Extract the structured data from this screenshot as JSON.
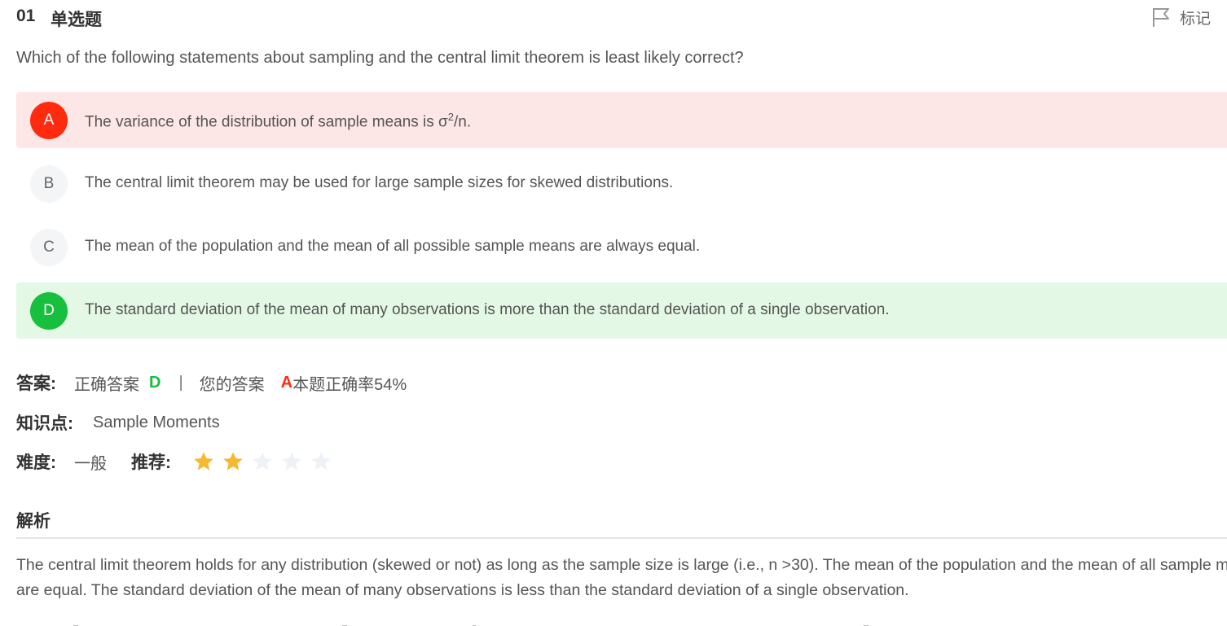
{
  "header": {
    "number": "01",
    "type": "单选题",
    "mark_label": "标记",
    "mark_icon": "flag-icon"
  },
  "question": {
    "text": "Which of the following statements about sampling and the central limit theorem is least likely correct?"
  },
  "options": [
    {
      "letter": "A",
      "text_before_sup": "The variance of the distribution of sample means is σ",
      "sup": "2",
      "text_after_sup": "/n.",
      "state": "wrong"
    },
    {
      "letter": "B",
      "text": "The central limit theorem may be used for large sample sizes for skewed distributions.",
      "state": "normal"
    },
    {
      "letter": "C",
      "text": "The mean of the population and the mean of all possible sample means are always equal.",
      "state": "normal"
    },
    {
      "letter": "D",
      "text": "The standard deviation of the mean of many observations is more than the standard deviation of a single observation.",
      "state": "right"
    }
  ],
  "answer": {
    "label": "答案:",
    "correct_label": "正确答案",
    "correct_value": "D",
    "separator": "|",
    "your_label": "您的答案",
    "your_value": "A",
    "rate_text": "本题正确率54%"
  },
  "knowledge": {
    "label": "知识点:",
    "value": "Sample Moments"
  },
  "difficulty": {
    "label": "难度:",
    "value": "一般",
    "recommend_label": "推荐:",
    "rating": 2,
    "max_rating": 5
  },
  "analysis": {
    "title": "解析",
    "text": "The central limit theorem holds for any distribution (skewed or not) as long as the sample size is large (i.e., n >30). The mean of the population and the mean of all sample means are equal. The standard deviation of the mean of many observations is less than the standard deviation of a single observation."
  },
  "colors": {
    "wrong_accent": "#ff2b0f",
    "wrong_bg": "#fde6e6",
    "right_accent": "#16c03c",
    "right_bg": "#e3f8e5",
    "star_on": "#f5b82e",
    "star_off": "#eef1f5"
  }
}
